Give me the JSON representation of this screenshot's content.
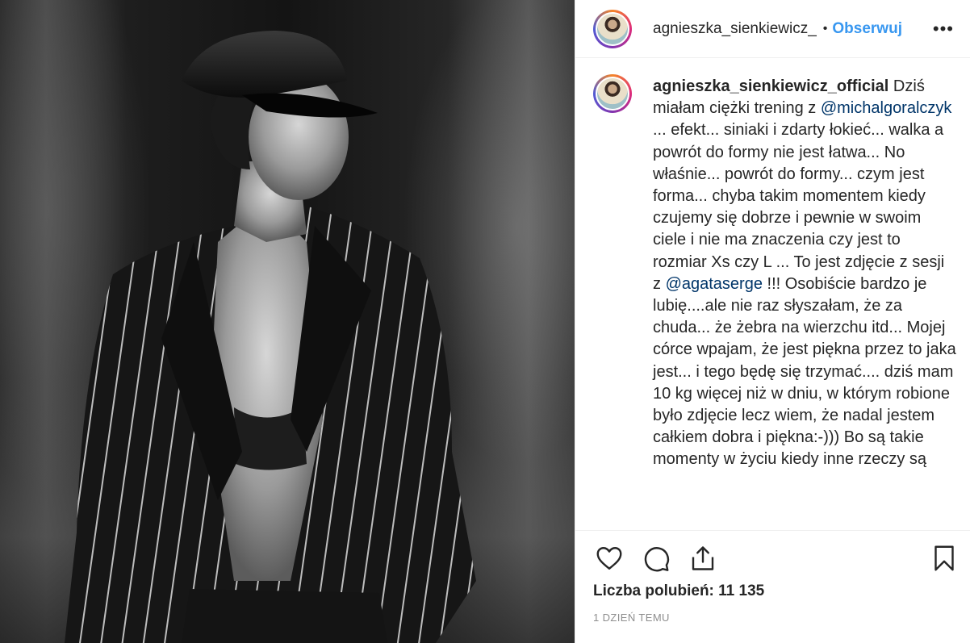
{
  "post": {
    "author": "agnieszka_sienkiewicz_official",
    "header_author": "agnieszka_sienkiewicz_",
    "header_separator": "•",
    "follow_label": "Obserwuj",
    "more_label": "•••",
    "caption": {
      "segments": [
        {
          "type": "username",
          "text": "agnieszka_sienkiewicz_official"
        },
        {
          "type": "text",
          "text": " Dziś miałam ciężki trening z "
        },
        {
          "type": "mention",
          "text": "@michalgoralczyk"
        },
        {
          "type": "text",
          "text": " ... efekt... siniaki i zdarty łokieć... walka a powrót do formy nie jest łatwa... No właśnie... powrót do formy... czym jest forma... chyba takim momentem kiedy czujemy się dobrze i pewnie w swoim ciele i nie ma znaczenia czy jest to rozmiar Xs czy L ... To jest zdjęcie z sesji z "
        },
        {
          "type": "mention",
          "text": "@agataserge"
        },
        {
          "type": "text",
          "text": " !!! Osobiście bardzo je lubię....ale nie raz słyszałam, że za chuda... że żebra na wierzchu itd... Mojej córce wpajam, że jest piękna przez to jaka jest... i tego będę się trzymać.... dziś mam 10 kg więcej niż w dniu, w którym robione było zdjęcie lecz wiem, że nadal jestem całkiem dobra i piękna:-))) Bo są takie momenty w życiu kiedy inne rzeczy są"
        }
      ]
    },
    "likes_text": "Liczba polubień: 11 135",
    "time_text": "1 DZIEŃ TEMU"
  },
  "icons": {
    "like": "heart-icon",
    "comment": "comment-icon",
    "share": "share-icon",
    "save": "bookmark-icon"
  },
  "colors": {
    "follow": "#3897f0",
    "mention": "#003569",
    "muted": "#8e8e8e"
  }
}
